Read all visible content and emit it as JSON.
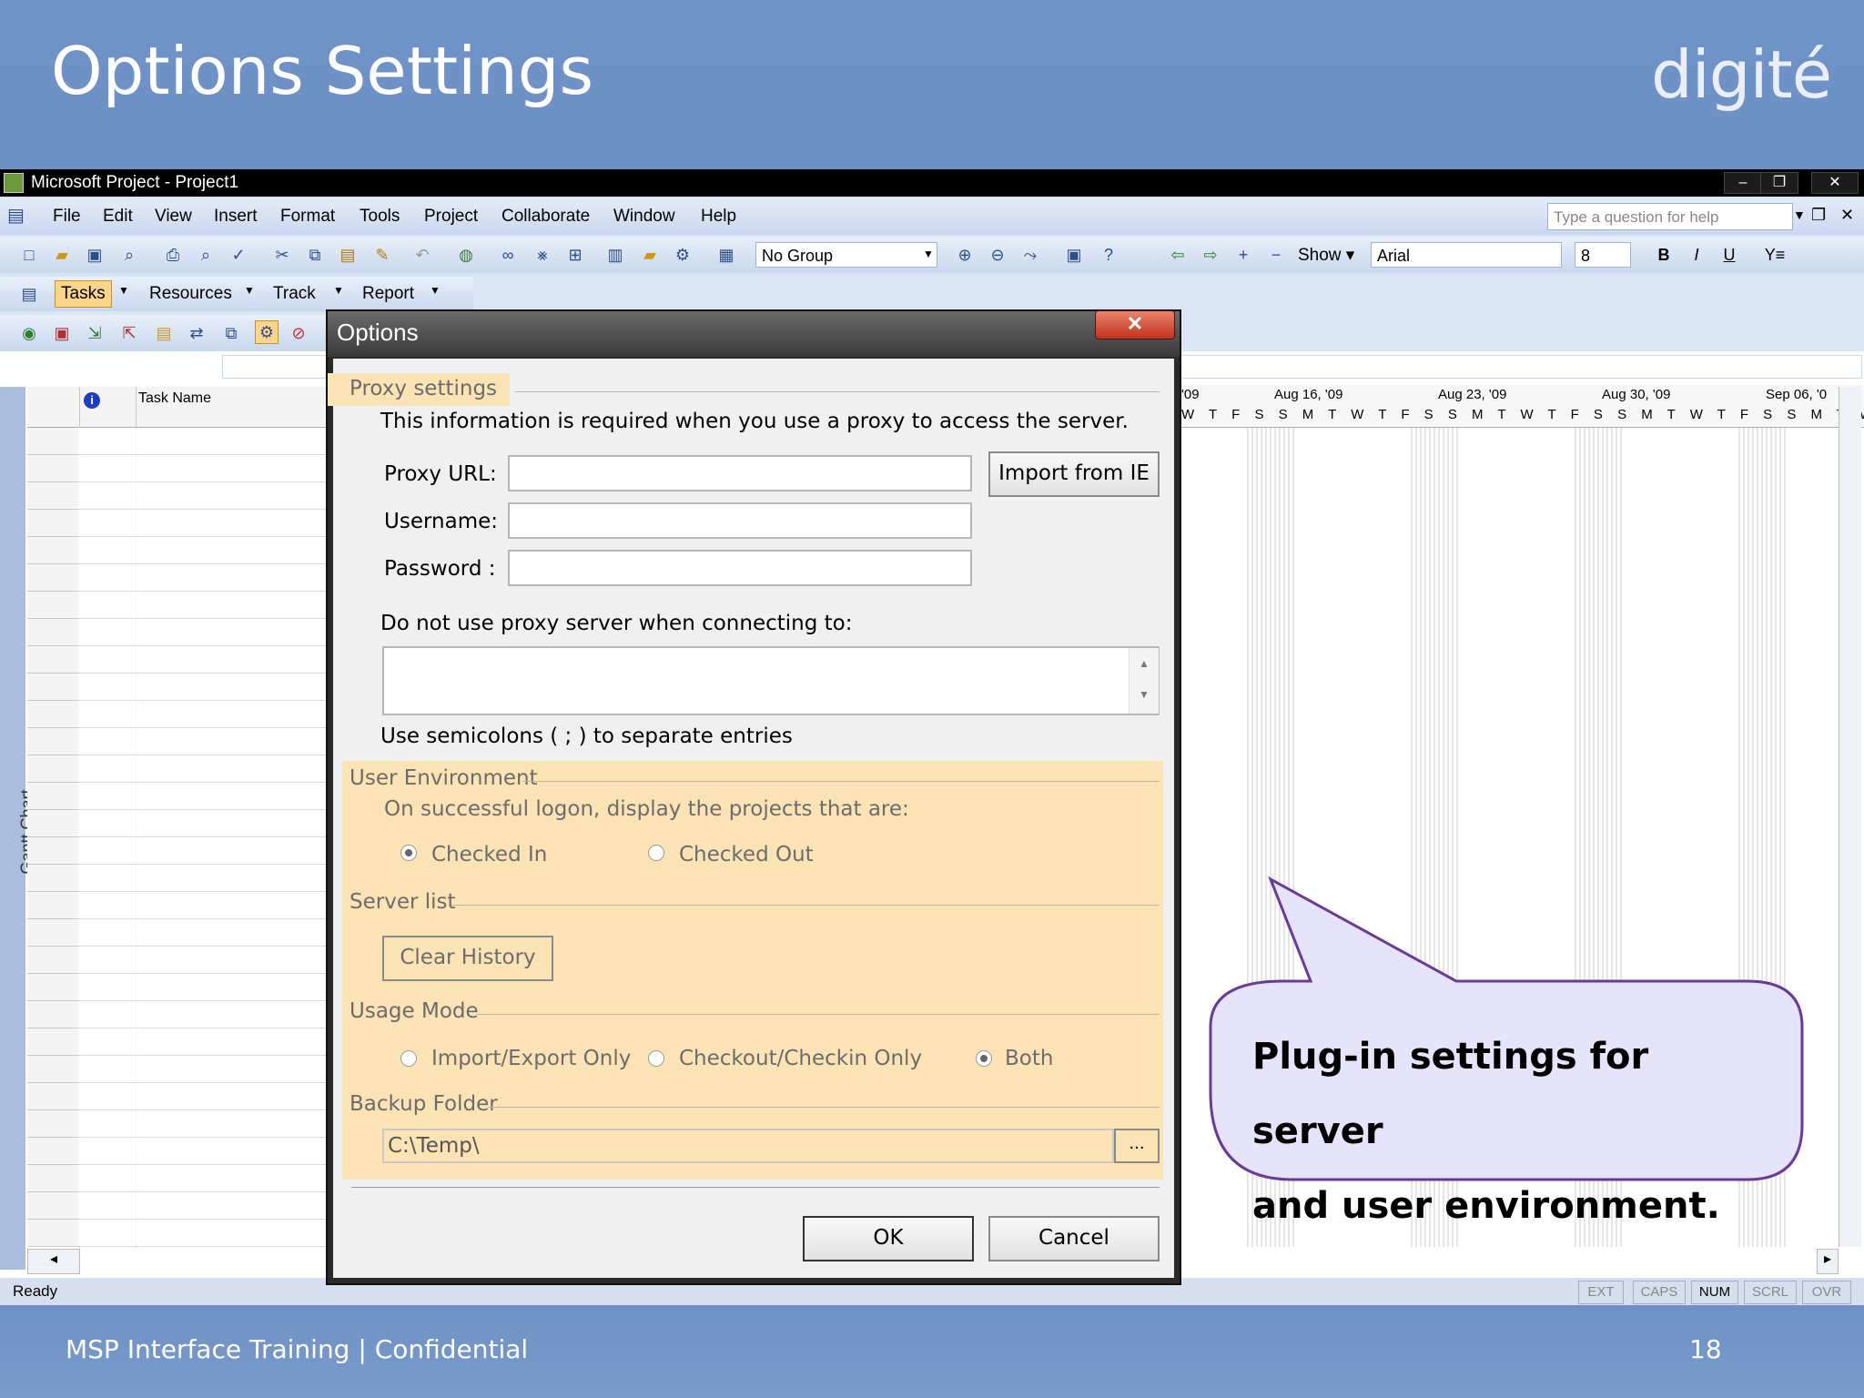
{
  "slide": {
    "title": "Options Settings",
    "logo": "digité",
    "footer": "MSP Interface Training | Confidential",
    "page_number": "18"
  },
  "app": {
    "window_title": "Microsoft Project - Project1",
    "menu": [
      "File",
      "Edit",
      "View",
      "Insert",
      "Format",
      "Tools",
      "Project",
      "Collaborate",
      "Window",
      "Help"
    ],
    "help_placeholder": "Type a question for help",
    "group_combo": "No Group",
    "show_label": "Show",
    "font_combo": "Arial",
    "size_combo": "8",
    "view_bar": {
      "tasks": "Tasks",
      "resources": "Resources",
      "track": "Track",
      "report": "Report"
    },
    "grid": {
      "col_task_name": "Task Name",
      "side_label": "Gantt Chart"
    },
    "timescale": {
      "weeks": [
        "'09",
        "Aug 16, '09",
        "Aug 23, '09",
        "Aug 30, '09",
        "Sep 06, '0"
      ],
      "days": "W T F S S M T W T F S S M T W T F S S M T W T F S S M T W"
    },
    "status": {
      "ready": "Ready",
      "ext": "EXT",
      "caps": "CAPS",
      "num": "NUM",
      "scrl": "SCRL",
      "ovr": "OVR"
    }
  },
  "dialog": {
    "title": "Options",
    "proxy_section": "Proxy settings",
    "proxy_info": "This information is required when you use a proxy to access the server.",
    "proxy_url_label": "Proxy URL:",
    "username_label": "Username:",
    "password_label": "Password :",
    "proxy_url_value": "",
    "username_value": "",
    "password_value": "",
    "import_button": "Import from IE",
    "bypass_label": "Do not use proxy server when connecting to:",
    "bypass_value": "",
    "semicolon_hint": "Use semicolons ( ; ) to separate entries",
    "user_env_section": "User Environment",
    "logon_label": "On successful logon, display the projects that are:",
    "checked_in": "Checked In",
    "checked_out": "Checked Out",
    "server_list_section": "Server list",
    "clear_history": "Clear History",
    "usage_mode_section": "Usage Mode",
    "import_export_only": "Import/Export Only",
    "checkout_checkin_only": "Checkout/Checkin Only",
    "both": "Both",
    "backup_section": "Backup Folder",
    "backup_value": "C:\\Temp\\",
    "browse_button": "...",
    "ok_button": "OK",
    "cancel_button": "Cancel"
  },
  "callout": {
    "line1": "Plug-in settings for server",
    "line2": "and user environment."
  },
  "colors": {
    "slide_bg": "#6b8fc4",
    "highlight": "#fbe3b5",
    "callout_fill": "#e6e4fb",
    "callout_stroke": "#6a3a96"
  }
}
